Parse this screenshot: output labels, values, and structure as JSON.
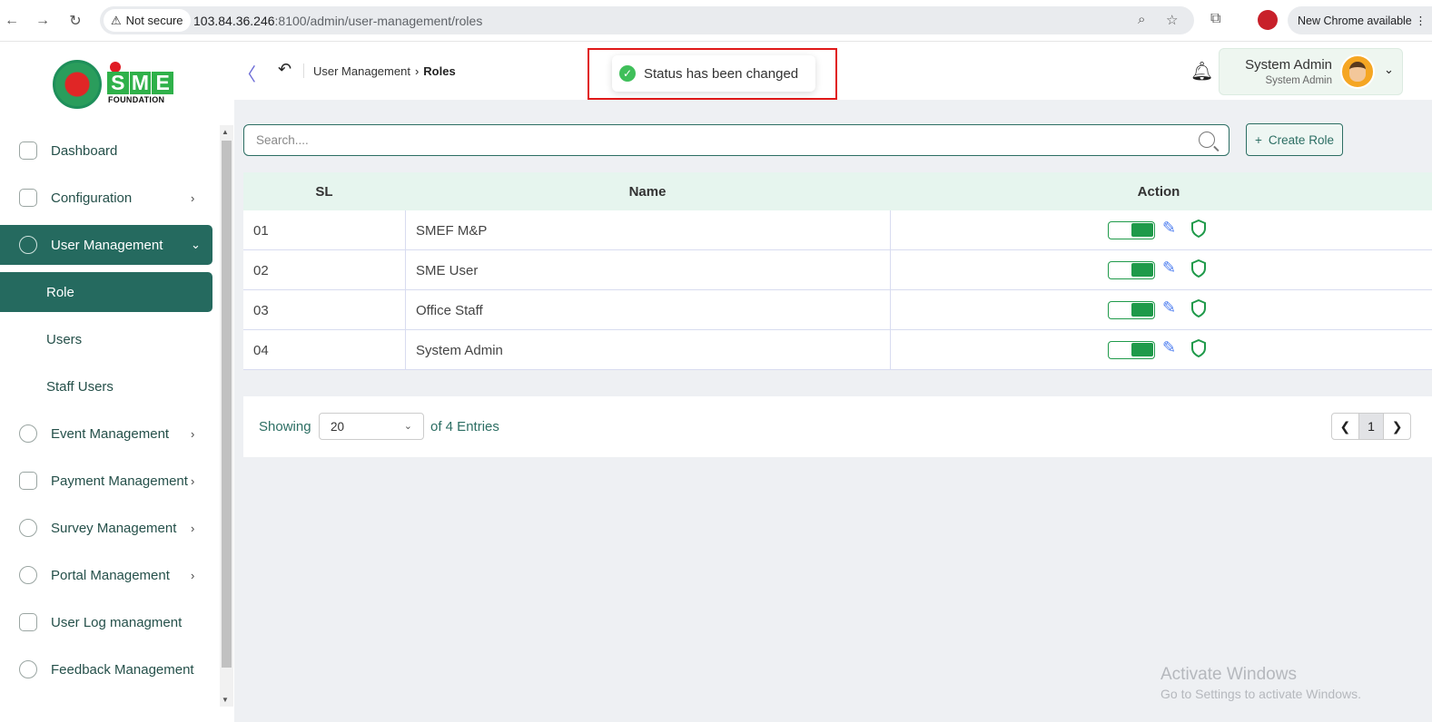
{
  "browser": {
    "security_label": "Not secure",
    "url_host": "103.84.36.246",
    "url_rest": ":8100/admin/user-management/roles",
    "update_label": "New Chrome available"
  },
  "header": {
    "logo_letters": [
      "S",
      "M",
      "E"
    ],
    "logo_subtitle": "FOUNDATION",
    "breadcrumb_parent": "User Management",
    "breadcrumb_current": "Roles",
    "toast_message": "Status has been changed",
    "user_name": "System Admin",
    "user_role": "System Admin"
  },
  "sidebar": {
    "items": [
      {
        "label": "Dashboard",
        "has_chevron": false
      },
      {
        "label": "Configuration",
        "has_chevron": true
      },
      {
        "label": "User Management",
        "has_chevron": true,
        "active": true
      },
      {
        "label": "Event Management",
        "has_chevron": true
      },
      {
        "label": "Payment Management",
        "has_chevron": true
      },
      {
        "label": "Survey Management",
        "has_chevron": true
      },
      {
        "label": "Portal Management",
        "has_chevron": true
      },
      {
        "label": "User Log managment",
        "has_chevron": false
      },
      {
        "label": "Feedback Management",
        "has_chevron": false
      }
    ],
    "subitems": [
      {
        "label": "Role",
        "active": true
      },
      {
        "label": "Users"
      },
      {
        "label": "Staff Users"
      }
    ]
  },
  "toolbar": {
    "search_placeholder": "Search....",
    "create_label": "Create Role"
  },
  "table": {
    "headers": {
      "sl": "SL",
      "name": "Name",
      "action": "Action"
    },
    "rows": [
      {
        "sl": "01",
        "name": "SMEF M&P",
        "status_on": true
      },
      {
        "sl": "02",
        "name": "SME User",
        "status_on": true
      },
      {
        "sl": "03",
        "name": "Office Staff",
        "status_on": true
      },
      {
        "sl": "04",
        "name": "System Admin",
        "status_on": true
      }
    ]
  },
  "pagination": {
    "showing_label": "Showing",
    "page_size": "20",
    "entries_label": "of 4 Entries",
    "current_page": "1"
  },
  "watermark": {
    "title": "Activate Windows",
    "subtitle": "Go to Settings to activate Windows."
  },
  "colors": {
    "primary": "#256a5f",
    "toggle_on": "#1f9a4a",
    "edit": "#4b7cf0",
    "toast_frame": "#e01818"
  }
}
